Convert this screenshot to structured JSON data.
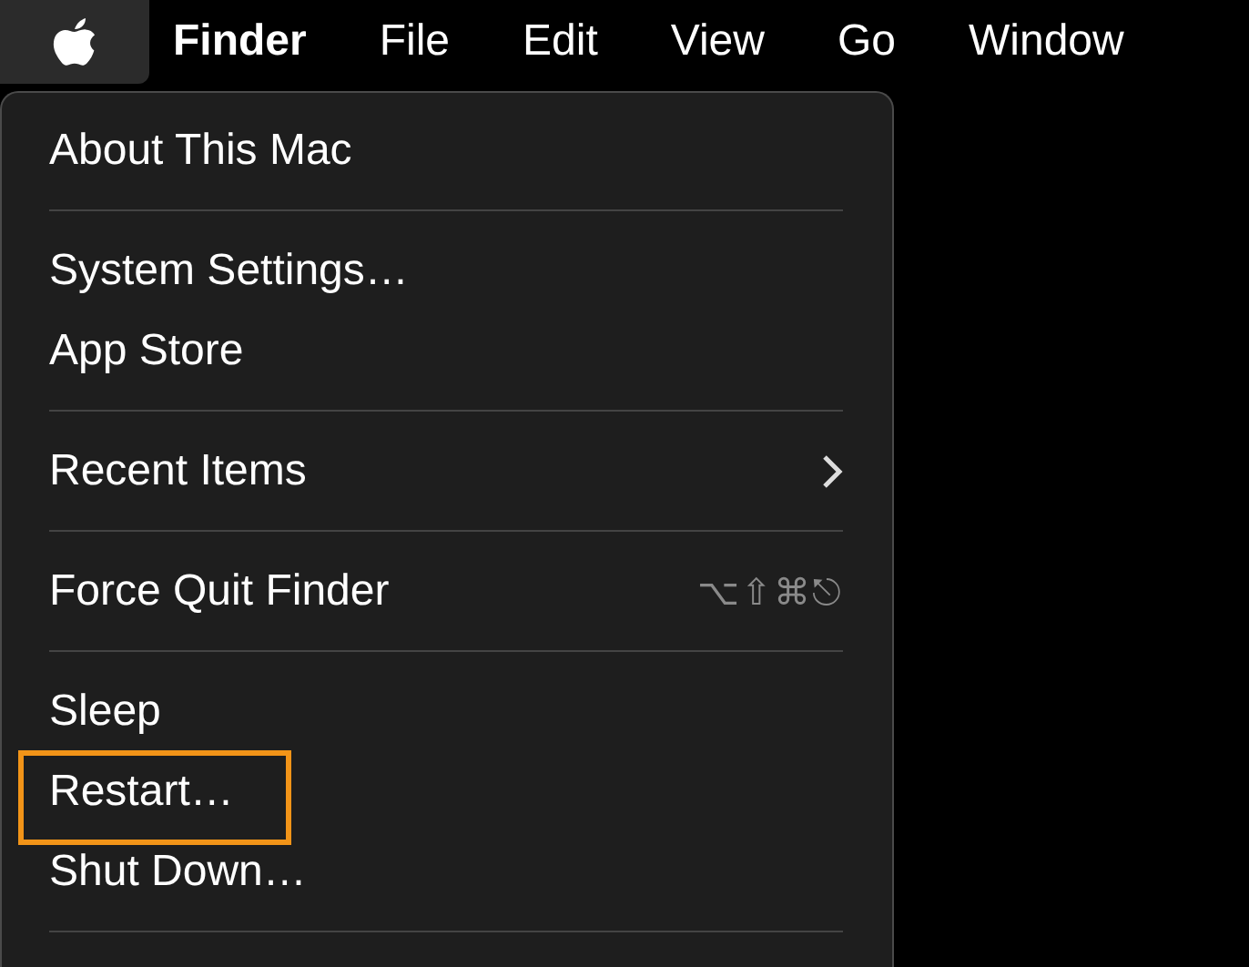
{
  "menu_bar": {
    "apple_menu_open": true,
    "items": [
      {
        "label": "Finder",
        "kind": "app"
      },
      {
        "label": "File",
        "kind": "menu"
      },
      {
        "label": "Edit",
        "kind": "menu"
      },
      {
        "label": "View",
        "kind": "menu"
      },
      {
        "label": "Go",
        "kind": "menu"
      },
      {
        "label": "Window",
        "kind": "menu"
      }
    ]
  },
  "apple_menu": {
    "groups": [
      [
        {
          "label": "About This Mac",
          "highlighted": false
        }
      ],
      [
        {
          "label": "System Settings…",
          "highlighted": false
        },
        {
          "label": "App Store",
          "highlighted": false
        }
      ],
      [
        {
          "label": "Recent Items",
          "submenu": true,
          "highlighted": false
        }
      ],
      [
        {
          "label": "Force Quit Finder",
          "shortcut": "⌥⇧⌘⎋",
          "highlighted": false
        }
      ],
      [
        {
          "label": "Sleep",
          "highlighted": false
        },
        {
          "label": "Restart…",
          "highlighted": true
        },
        {
          "label": "Shut Down…",
          "highlighted": false
        }
      ]
    ]
  }
}
